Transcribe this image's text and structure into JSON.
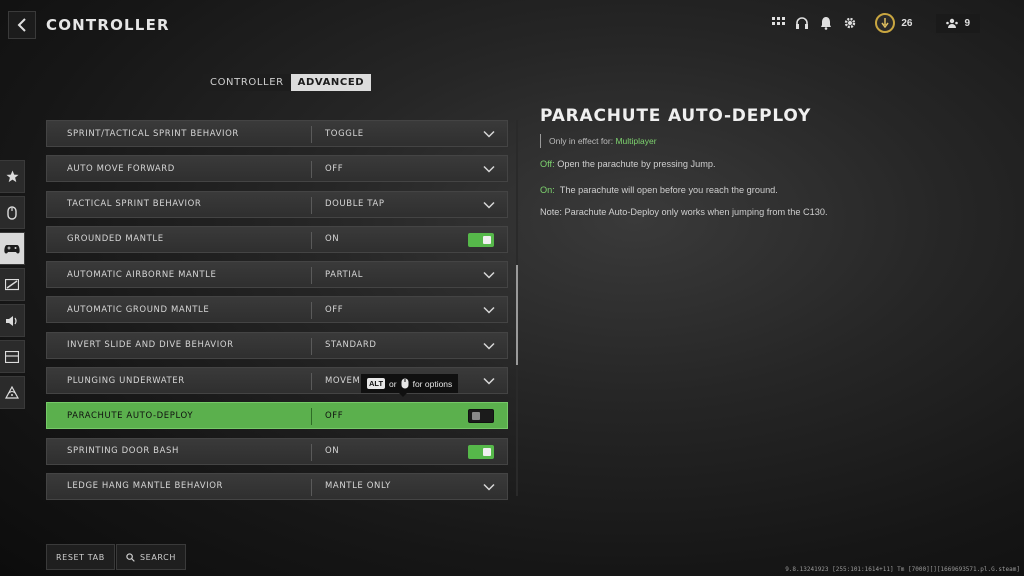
{
  "header": {
    "title": "CONTROLLER",
    "level": "26",
    "party_count": "9"
  },
  "tabs": [
    {
      "label": "CONTROLLER",
      "active": false
    },
    {
      "label": "ADVANCED",
      "active": true
    }
  ],
  "side_nav": [
    {
      "icon": "star-icon",
      "active": false
    },
    {
      "icon": "mouse-icon",
      "active": false
    },
    {
      "icon": "gamepad-icon",
      "active": true
    },
    {
      "icon": "display-icon",
      "active": false
    },
    {
      "icon": "speaker-icon",
      "active": false
    },
    {
      "icon": "interface-icon",
      "active": false
    },
    {
      "icon": "network-icon",
      "active": false
    }
  ],
  "settings": [
    {
      "label": "SPRINT/TACTICAL SPRINT BEHAVIOR",
      "value": "TOGGLE",
      "control": "dropdown"
    },
    {
      "label": "AUTO MOVE FORWARD",
      "value": "OFF",
      "control": "dropdown"
    },
    {
      "label": "TACTICAL SPRINT BEHAVIOR",
      "value": "DOUBLE TAP",
      "control": "dropdown"
    },
    {
      "label": "GROUNDED MANTLE",
      "value": "ON",
      "control": "toggle-on"
    },
    {
      "label": "AUTOMATIC AIRBORNE MANTLE",
      "value": "PARTIAL",
      "control": "dropdown"
    },
    {
      "label": "AUTOMATIC GROUND MANTLE",
      "value": "OFF",
      "control": "dropdown"
    },
    {
      "label": "INVERT SLIDE AND DIVE BEHAVIOR",
      "value": "STANDARD",
      "control": "dropdown"
    },
    {
      "label": "PLUNGING UNDERWATER",
      "value": "MOVEMEN",
      "control": "dropdown"
    },
    {
      "label": "PARACHUTE AUTO-DEPLOY",
      "value": "OFF",
      "control": "toggle-off",
      "selected": true
    },
    {
      "label": "SPRINTING DOOR BASH",
      "value": "ON",
      "control": "toggle-on"
    },
    {
      "label": "LEDGE HANG MANTLE BEHAVIOR",
      "value": "MANTLE ONLY",
      "control": "dropdown"
    }
  ],
  "tooltip": {
    "key": "ALT",
    "or": "or",
    "text": "for options"
  },
  "detail": {
    "title": "PARACHUTE AUTO-DEPLOY",
    "scope_prefix": "Only in effect for: ",
    "scope_value": "Multiplayer",
    "off_key": "Off:",
    "off_text": " Open the parachute by pressing Jump.",
    "on_key": "On:",
    "on_text": "  The parachute will open before you reach the ground.",
    "note": "Note: Parachute Auto-Deploy only works when jumping from the C130."
  },
  "footer": {
    "reset_label": "RESET TAB",
    "search_label": "SEARCH"
  },
  "build_info": "9.8.13241923 [255:101:1614+11] Tm [7000][][1669693571.pl.G.steam]",
  "colors": {
    "accent_green": "#5bb04d",
    "highlight_text_green": "#7ed46f",
    "level_ring": "#c9a640"
  }
}
